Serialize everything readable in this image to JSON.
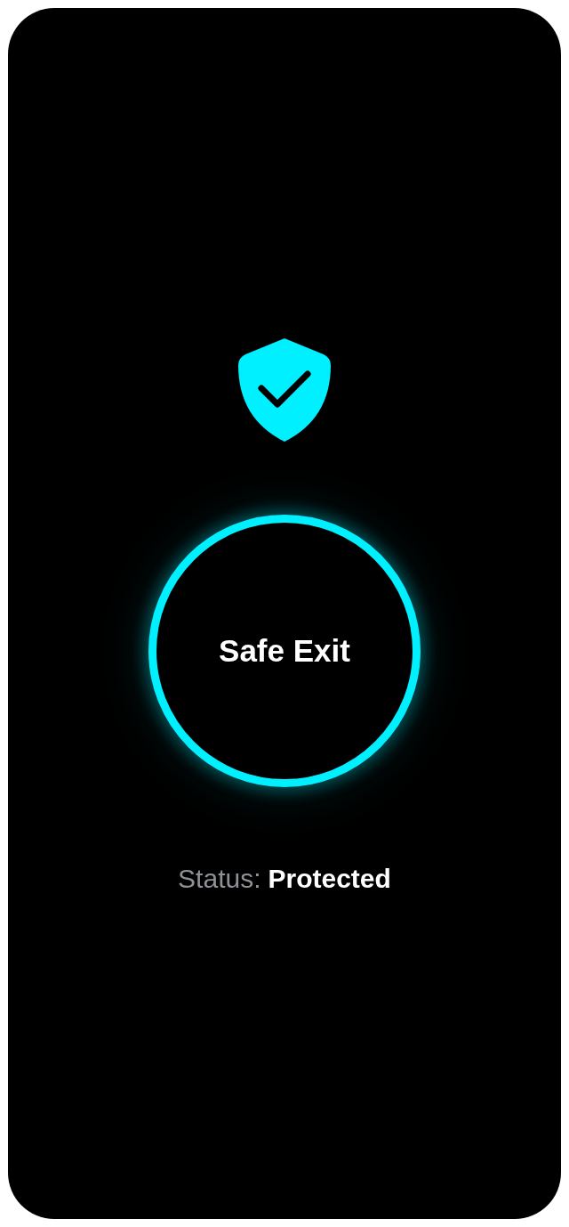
{
  "button": {
    "label": "Safe Exit"
  },
  "status": {
    "label": "Status:",
    "value": "Protected"
  }
}
